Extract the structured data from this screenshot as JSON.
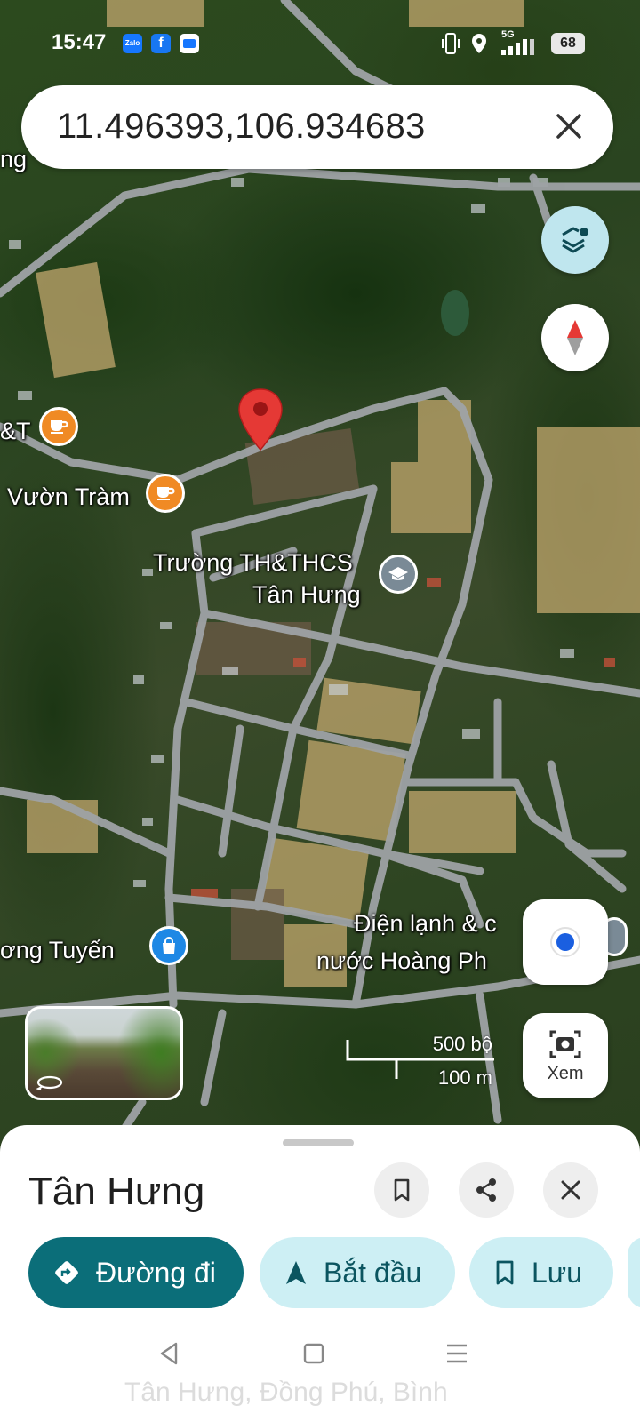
{
  "status_bar": {
    "time": "15:47",
    "apps": [
      "Zalo",
      "f",
      ""
    ],
    "network": "5G",
    "battery": "68"
  },
  "search": {
    "query": "11.496393,106.934683"
  },
  "map": {
    "labels": {
      "top_partial": "ng",
      "cafe_left_partial": "&T",
      "cafe_vuon_tram": "Vườn Tràm",
      "school_line1": "Trường TH&THCS",
      "school_line2": "Tân Hưng",
      "shop_partial": "ơng Tuyến",
      "dien_lanh_line1": "Điện lạnh & c",
      "dien_lanh_line2": "nước Hoàng Ph"
    },
    "scale": {
      "imperial": "500 bộ",
      "metric": "100 m"
    },
    "colors": {
      "pin": "#e53935",
      "cafe": "#f08a24",
      "school": "#7a8a96",
      "shop": "#1e88e5",
      "location_dot": "#1a5fe0"
    }
  },
  "buttons": {
    "xem_label": "Xem"
  },
  "sheet": {
    "title": "Tân Hưng",
    "directions_label": "Đường đi",
    "start_label": "Bắt đầu",
    "save_label": "Lưu",
    "ghost_text": "Tân Hưng, Đồng Phú, Bình",
    "accent": "#0b6e79"
  }
}
